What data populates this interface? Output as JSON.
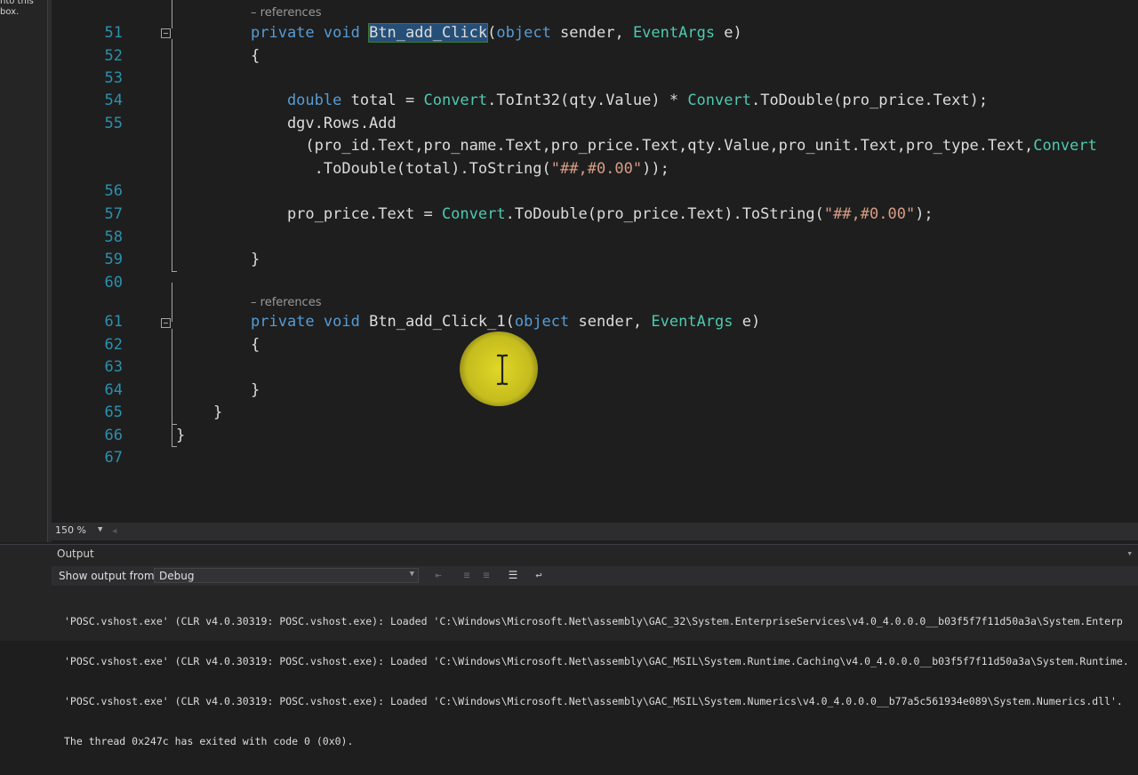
{
  "toolbox_hint": "nto this\nbox.",
  "codelens": [
    "– references",
    "– references"
  ],
  "lines": [
    {
      "num": "51",
      "code": [
        {
          "t": "private ",
          "c": "kw"
        },
        {
          "t": "void ",
          "c": "kw"
        },
        {
          "t": "Btn_add_Click",
          "c": "hl"
        },
        {
          "t": "(",
          "c": ""
        },
        {
          "t": "object ",
          "c": "kw"
        },
        {
          "t": "sender, ",
          "c": ""
        },
        {
          "t": "EventArgs ",
          "c": "ty"
        },
        {
          "t": "e)",
          "c": ""
        }
      ]
    },
    {
      "num": "52",
      "code": [
        {
          "t": "{",
          "c": ""
        }
      ]
    },
    {
      "num": "53",
      "code": []
    },
    {
      "num": "54",
      "code": [
        {
          "t": "    double ",
          "c": "kw"
        },
        {
          "t": "total = ",
          "c": ""
        },
        {
          "t": "Convert",
          "c": "ty"
        },
        {
          "t": ".ToInt32(qty.Value) * ",
          "c": ""
        },
        {
          "t": "Convert",
          "c": "ty"
        },
        {
          "t": ".ToDouble(pro_price.Text);",
          "c": ""
        }
      ]
    },
    {
      "num": "55",
      "code": [
        {
          "t": "    dgv.Rows.Add",
          "c": ""
        }
      ]
    },
    {
      "num": "",
      "code": [
        {
          "t": "      (pro_id.Text,pro_name.Text,pro_price.Text,qty.Value,pro_unit.Text,pro_type.Text,",
          "c": ""
        },
        {
          "t": "Convert",
          "c": "ty"
        }
      ]
    },
    {
      "num": "",
      "code": [
        {
          "t": "       .ToDouble(total).ToString(",
          "c": ""
        },
        {
          "t": "\"##,#0.00\"",
          "c": "str"
        },
        {
          "t": "));",
          "c": ""
        }
      ]
    },
    {
      "num": "56",
      "code": []
    },
    {
      "num": "57",
      "code": [
        {
          "t": "    pro_price.Text = ",
          "c": ""
        },
        {
          "t": "Convert",
          "c": "ty"
        },
        {
          "t": ".ToDouble(pro_price.Text).ToString(",
          "c": ""
        },
        {
          "t": "\"##,#0.00\"",
          "c": "str"
        },
        {
          "t": ");",
          "c": ""
        }
      ]
    },
    {
      "num": "58",
      "code": []
    },
    {
      "num": "59",
      "code": [
        {
          "t": "}",
          "c": ""
        }
      ]
    },
    {
      "num": "60",
      "code": []
    },
    {
      "num": "61",
      "code": [
        {
          "t": "private ",
          "c": "kw"
        },
        {
          "t": "void ",
          "c": "kw"
        },
        {
          "t": "Btn_add_Click_1(",
          "c": ""
        },
        {
          "t": "object ",
          "c": "kw"
        },
        {
          "t": "sender, ",
          "c": ""
        },
        {
          "t": "EventArgs ",
          "c": "ty"
        },
        {
          "t": "e)",
          "c": ""
        }
      ]
    },
    {
      "num": "62",
      "code": [
        {
          "t": "{",
          "c": ""
        }
      ]
    },
    {
      "num": "63",
      "code": []
    },
    {
      "num": "64",
      "code": [
        {
          "t": "}",
          "c": ""
        }
      ]
    },
    {
      "num": "65",
      "code": [
        {
          "t": "}",
          "c": ""
        }
      ]
    },
    {
      "num": "66",
      "code": [
        {
          "t": "}",
          "c": ""
        }
      ]
    },
    {
      "num": "67",
      "code": []
    }
  ],
  "zoom": {
    "label": "150 %"
  },
  "output": {
    "title": "Output",
    "show_output_from": "Show output from:",
    "source": "Debug",
    "lines": [
      "'POSC.vshost.exe' (CLR v4.0.30319: POSC.vshost.exe): Loaded 'C:\\Windows\\Microsoft.Net\\assembly\\GAC_32\\System.EnterpriseServices\\v4.0_4.0.0.0__b03f5f7f11d50a3a\\System.Enterp",
      "'POSC.vshost.exe' (CLR v4.0.30319: POSC.vshost.exe): Loaded 'C:\\Windows\\Microsoft.Net\\assembly\\GAC_MSIL\\System.Runtime.Caching\\v4.0_4.0.0.0__b03f5f7f11d50a3a\\System.Runtime.",
      "'POSC.vshost.exe' (CLR v4.0.30319: POSC.vshost.exe): Loaded 'C:\\Windows\\Microsoft.Net\\assembly\\GAC_MSIL\\System.Numerics\\v4.0_4.0.0.0__b77a5c561934e089\\System.Numerics.dll'.",
      "The thread 0x247c has exited with code 0 (0x0)."
    ]
  }
}
